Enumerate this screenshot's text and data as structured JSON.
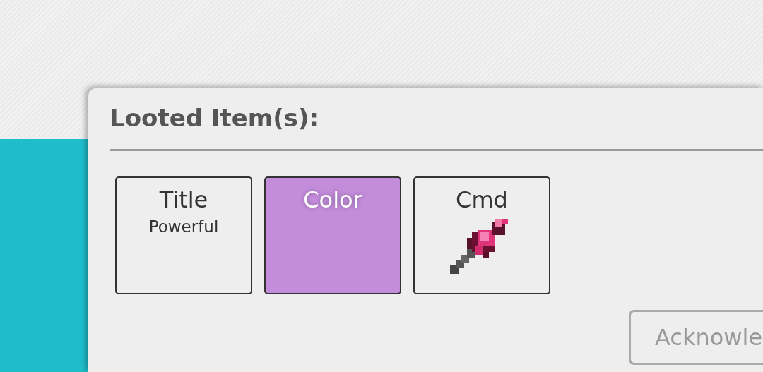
{
  "dialog": {
    "title": "Looted Item(s):",
    "items": [
      {
        "kind": "text",
        "label": "Title",
        "detail": "Powerful"
      },
      {
        "kind": "color",
        "label": "Color",
        "color": "#c48ddc"
      },
      {
        "kind": "icon",
        "label": "Cmd"
      }
    ],
    "button": {
      "label": "Acknowle",
      "disabled": true
    }
  }
}
